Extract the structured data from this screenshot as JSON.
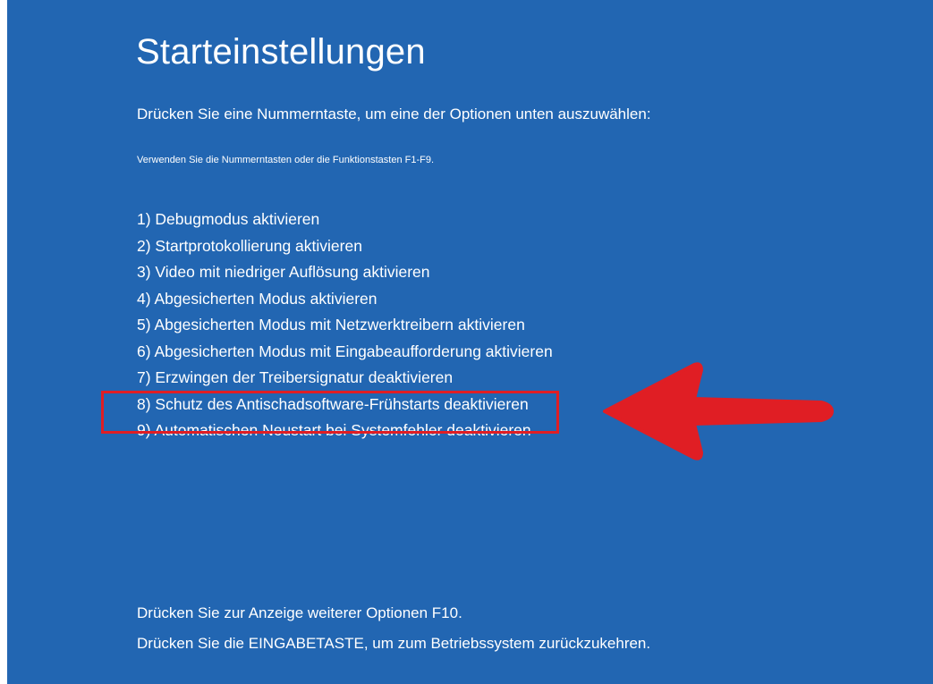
{
  "screen": {
    "title": "Starteinstellungen",
    "prompt": "Drücken Sie eine Nummerntaste, um eine der Optionen unten auszuwählen:",
    "hint": "Verwenden Sie die Nummerntasten oder die Funktionstasten F1-F9.",
    "options": [
      {
        "label": "1) Debugmodus aktivieren"
      },
      {
        "label": "2) Startprotokollierung aktivieren"
      },
      {
        "label": "3) Video mit niedriger Auflösung aktivieren"
      },
      {
        "label": "4) Abgesicherten Modus aktivieren"
      },
      {
        "label": "5) Abgesicherten Modus mit Netzwerktreibern aktivieren"
      },
      {
        "label": "6) Abgesicherten Modus mit Eingabeaufforderung aktivieren"
      },
      {
        "label": "7) Erzwingen der Treibersignatur deaktivieren"
      },
      {
        "label": "8) Schutz des Antischadsoftware-Frühstarts deaktivieren"
      },
      {
        "label": "9) Automatischen Neustart bei Systemfehler deaktivieren"
      }
    ],
    "highlighted_option": "7) Erzwingen der Treibersignatur deaktivieren",
    "footer_more": "Drücken Sie zur Anzeige weiterer Optionen F10.",
    "footer_enter": "Drücken Sie die EINGABETASTE, um zum Betriebssystem zurückzukehren."
  },
  "colors": {
    "background": "#2266b2",
    "text": "#ffffff",
    "annotation": "#e01e24"
  }
}
